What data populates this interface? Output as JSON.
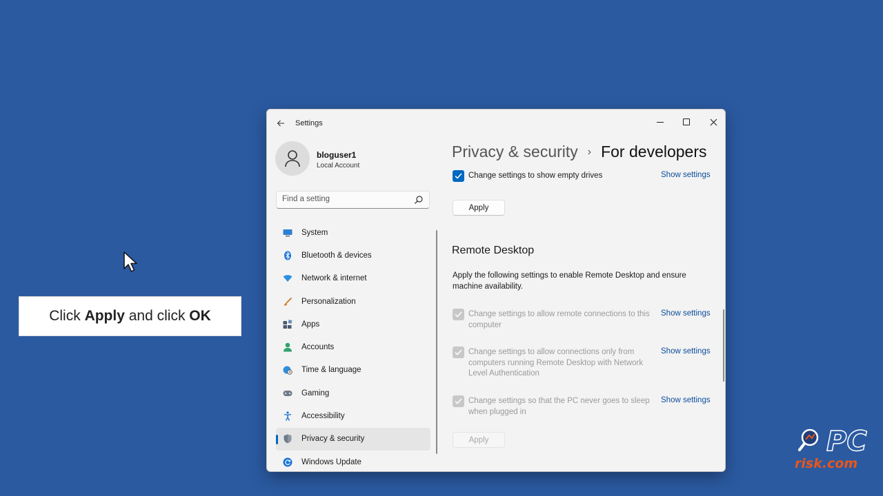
{
  "window": {
    "title": "Settings",
    "controls": {
      "minimize": "minimize",
      "maximize": "maximize",
      "close": "close"
    }
  },
  "profile": {
    "name": "bloguser1",
    "account_type": "Local Account"
  },
  "search": {
    "placeholder": "Find a setting"
  },
  "sidebar": {
    "items": [
      {
        "label": "System",
        "icon": "monitor-icon",
        "color": "#2f7fd3"
      },
      {
        "label": "Bluetooth & devices",
        "icon": "bluetooth-icon",
        "color": "#1a73d9"
      },
      {
        "label": "Network & internet",
        "icon": "wifi-icon",
        "color": "#2d8fe0"
      },
      {
        "label": "Personalization",
        "icon": "brush-icon",
        "color": "#e07a2d"
      },
      {
        "label": "Apps",
        "icon": "apps-icon",
        "color": "#4b5b73"
      },
      {
        "label": "Accounts",
        "icon": "person-icon",
        "color": "#2ea36b"
      },
      {
        "label": "Time & language",
        "icon": "globe-clock-icon",
        "color": "#2d8fe0"
      },
      {
        "label": "Gaming",
        "icon": "gamepad-icon",
        "color": "#6f7b8a"
      },
      {
        "label": "Accessibility",
        "icon": "accessibility-icon",
        "color": "#1a6fd0"
      },
      {
        "label": "Privacy & security",
        "icon": "shield-icon",
        "color": "#6f7b8a",
        "active": true
      },
      {
        "label": "Windows Update",
        "icon": "refresh-icon",
        "color": "#1a73d9"
      }
    ]
  },
  "breadcrumb": {
    "parent": "Privacy & security",
    "separator": "›",
    "current": "For developers"
  },
  "content": {
    "empty_drives": {
      "label": "Change settings to show empty drives",
      "link": "Show settings",
      "checked": true
    },
    "apply_top": "Apply",
    "remote_desktop": {
      "title": "Remote Desktop",
      "description": "Apply the following settings to enable Remote Desktop and ensure machine availability.",
      "options": [
        {
          "label": "Change settings to allow remote connections to this computer",
          "link": "Show settings",
          "checked": true,
          "disabled": true
        },
        {
          "label": "Change settings to allow connections only from computers running Remote Desktop with Network Level Authentication",
          "link": "Show settings",
          "checked": true,
          "disabled": true
        },
        {
          "label": "Change settings so that the PC never goes to sleep when plugged in",
          "link": "Show settings",
          "checked": true,
          "disabled": true
        }
      ],
      "apply": "Apply"
    }
  },
  "callout": {
    "prefix": "Click ",
    "apply": "Apply",
    "middle": " and click ",
    "ok": "OK"
  },
  "watermark": {
    "pc": "PC",
    "risk": "risk.com"
  },
  "colors": {
    "desktop": "#2b5aa1",
    "accent": "#0067c0",
    "link": "#0a4d9c"
  }
}
